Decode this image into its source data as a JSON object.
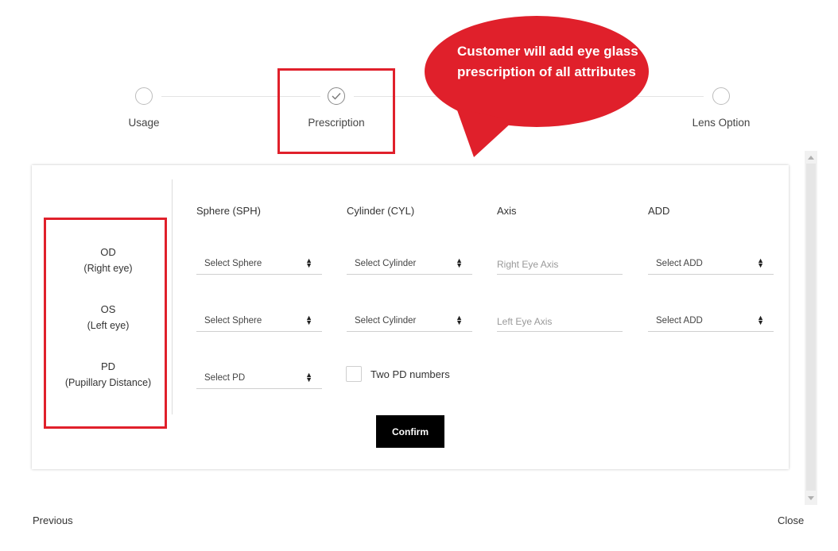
{
  "stepper": {
    "steps": [
      {
        "label": "Usage",
        "state": "pending"
      },
      {
        "label": "Prescription",
        "state": "active"
      },
      {
        "label": "Lens Option",
        "state": "pending"
      }
    ],
    "active_icon": "check-icon"
  },
  "callout": {
    "text": "Customer will add eye glass prescription of all attributes",
    "color": "#e0202b"
  },
  "rows": {
    "od": {
      "title": "OD",
      "subtitle": "(Right eye)"
    },
    "os": {
      "title": "OS",
      "subtitle": "(Left eye)"
    },
    "pd": {
      "title": "PD",
      "subtitle": "(Pupillary Distance)"
    }
  },
  "columns": [
    "Sphere (SPH)",
    "Cylinder (CYL)",
    "Axis",
    "ADD"
  ],
  "right_eye": {
    "sphere": "Select Sphere",
    "cylinder": "Select Cylinder",
    "axis_placeholder": "Right Eye Axis",
    "add": "Select ADD"
  },
  "left_eye": {
    "sphere": "Select Sphere",
    "cylinder": "Select Cylinder",
    "axis_placeholder": "Left Eye Axis",
    "add": "Select ADD"
  },
  "pd": {
    "select": "Select PD",
    "two_pd_label": "Two PD numbers",
    "two_pd_checked": false
  },
  "confirm_label": "Confirm",
  "footer": {
    "previous": "Previous",
    "close": "Close"
  },
  "colors": {
    "highlight": "#e0202b",
    "button": "#000000"
  }
}
